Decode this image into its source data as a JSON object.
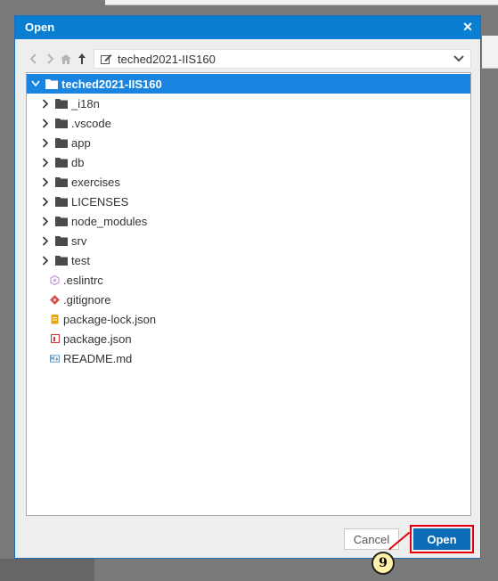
{
  "dialog": {
    "title": "Open",
    "close_icon": "close-icon",
    "accent_color": "#0a7ed1",
    "selection_color": "#1a85e0"
  },
  "navbar": {
    "back_icon": "chevron-left-icon",
    "forward_icon": "chevron-right-icon",
    "home_icon": "home-icon",
    "up_icon": "arrow-up-icon",
    "path_edit_icon": "edit-icon",
    "path": "teched2021-IIS160",
    "dropdown_icon": "chevron-down-icon"
  },
  "tree": {
    "root": {
      "label": "teched2021-IIS160",
      "expanded": true,
      "selected": true
    },
    "folders": [
      {
        "label": "_i18n"
      },
      {
        "label": ".vscode"
      },
      {
        "label": "app"
      },
      {
        "label": "db"
      },
      {
        "label": "exercises"
      },
      {
        "label": "LICENSES"
      },
      {
        "label": "node_modules"
      },
      {
        "label": "srv"
      },
      {
        "label": "test"
      }
    ],
    "files": [
      {
        "label": ".eslintrc",
        "icon": "eslint-icon",
        "color": "#c9a0dc"
      },
      {
        "label": ".gitignore",
        "icon": "git-icon",
        "color": "#d9534f"
      },
      {
        "label": "package-lock.json",
        "icon": "json-lock-icon",
        "color": "#e8a317"
      },
      {
        "label": "package.json",
        "icon": "npm-icon",
        "color": "#cb3837"
      },
      {
        "label": "README.md",
        "icon": "markdown-icon",
        "color": "#5b8fb9"
      }
    ]
  },
  "buttons": {
    "cancel": "Cancel",
    "open": "Open"
  },
  "annotation": {
    "step": "9",
    "highlight_color": "#e4000f"
  }
}
